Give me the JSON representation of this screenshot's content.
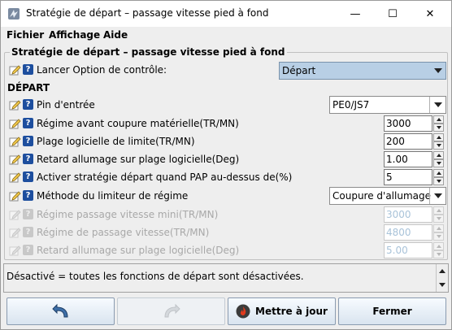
{
  "window": {
    "title": "Stratégie de départ – passage vitesse pied à fond",
    "controls": {
      "minimize": "—",
      "maximize": "☐",
      "close": "✕"
    }
  },
  "menu": [
    {
      "label": "Fichier"
    },
    {
      "label": "Affichage"
    },
    {
      "label": "Aide"
    }
  ],
  "panel": {
    "title": "Stratégie de départ – passage vitesse pied à fond",
    "launch": {
      "label": "Lancer Option de contrôle:",
      "value": "Départ"
    },
    "section": "DÉPART",
    "pin": {
      "label": "Pin d'entrée",
      "value": "PE0/JS7"
    },
    "fields": [
      {
        "label": "Régime avant coupure matérielle(TR/MN)",
        "value": "3000"
      },
      {
        "label": "Plage logicielle de limite(TR/MN)",
        "value": "200"
      },
      {
        "label": "Retard allumage sur plage logicielle(Deg)",
        "value": "1.00"
      },
      {
        "label": "Activer stratégie départ quand PAP au-dessus de(%)",
        "value": "5"
      }
    ],
    "method": {
      "label": "Méthode du limiteur de régime",
      "value": "Coupure d'allumage"
    },
    "disabled_fields": [
      {
        "label": "Régime passage vitesse mini(TR/MN)",
        "value": "3000"
      },
      {
        "label": "Régime de passage vitesse(TR/MN)",
        "value": "4800"
      },
      {
        "label": "Retard allumage sur plage logicielle(Deg)",
        "value": "5.00"
      }
    ]
  },
  "status": {
    "text": "Désactivé = toutes les fonctions de départ sont désactivées."
  },
  "buttons": {
    "undo": "",
    "redo": "",
    "burn": "Mettre à jour",
    "close": "Fermer"
  },
  "colors": {
    "accent": "#1d4e9e",
    "combo_selected": "#b8cfe5",
    "burn_icon": "#e03a1e"
  }
}
